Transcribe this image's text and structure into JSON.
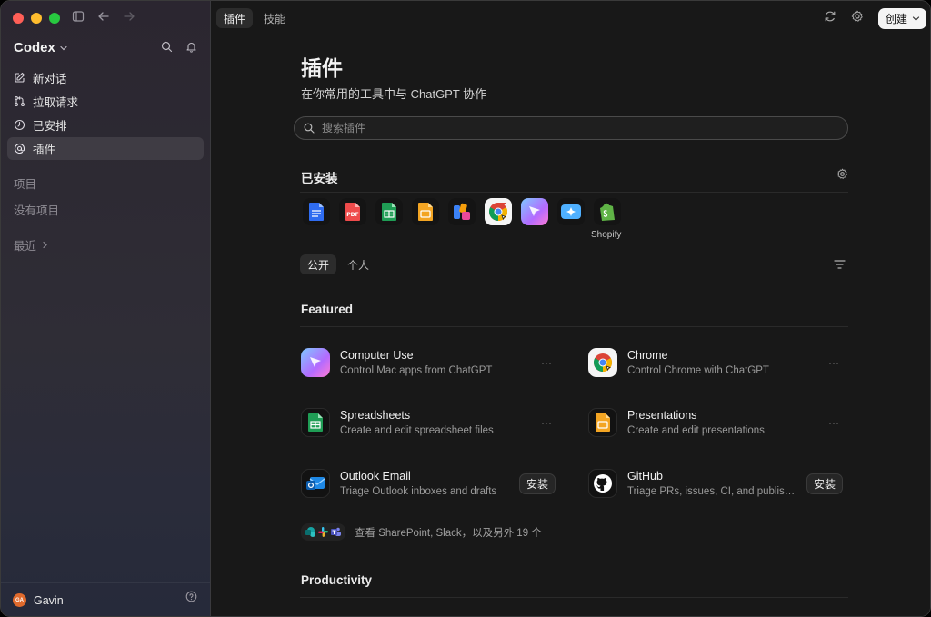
{
  "app": {
    "name": "Codex"
  },
  "sidebar": {
    "items": [
      {
        "label": "新对话",
        "icon": "compose-icon"
      },
      {
        "label": "拉取请求",
        "icon": "pull-request-icon"
      },
      {
        "label": "已安排",
        "icon": "clock-icon"
      },
      {
        "label": "插件",
        "icon": "at-icon"
      }
    ],
    "projects_label": "项目",
    "no_projects_label": "没有项目",
    "recent_label": "最近",
    "user": {
      "name": "Gavin",
      "initials": "GA"
    }
  },
  "header": {
    "tabs": [
      {
        "label": "插件"
      },
      {
        "label": "技能"
      }
    ],
    "create_label": "创建"
  },
  "page": {
    "title": "插件",
    "subtitle": "在你常用的工具中与 ChatGPT 协作",
    "search_placeholder": "搜索插件"
  },
  "installed": {
    "title": "已安装",
    "apps": [
      "docs-icon",
      "pdf-icon",
      "sheets-icon",
      "slides-icon",
      "blocks-icon",
      "chrome-icon",
      "computer-use-icon",
      "sparkle-icon",
      "shopify-icon"
    ],
    "hover_label": "Shopify"
  },
  "filters": [
    {
      "label": "公开"
    },
    {
      "label": "个人"
    }
  ],
  "featured": {
    "title": "Featured",
    "plugins": [
      {
        "name": "Computer Use",
        "desc": "Control Mac apps from ChatGPT",
        "action": "more"
      },
      {
        "name": "Chrome",
        "desc": "Control Chrome with ChatGPT",
        "action": "more"
      },
      {
        "name": "Spreadsheets",
        "desc": "Create and edit spreadsheet files",
        "action": "more"
      },
      {
        "name": "Presentations",
        "desc": "Create and edit presentations",
        "action": "more"
      },
      {
        "name": "Outlook Email",
        "desc": "Triage Outlook inboxes and drafts",
        "action": "install",
        "action_label": "安装"
      },
      {
        "name": "GitHub",
        "desc": "Triage PRs, issues, CI, and publish changes",
        "action": "install",
        "action_label": "安装"
      }
    ],
    "more_glyph": "···",
    "see_more": "查看 SharePoint, Slack，以及另外 19 个"
  },
  "productivity": {
    "title": "Productivity"
  },
  "colors": {
    "accent": "#f4f4f4",
    "sidebar_bg": "#2d2a33",
    "main_bg": "#181818"
  }
}
